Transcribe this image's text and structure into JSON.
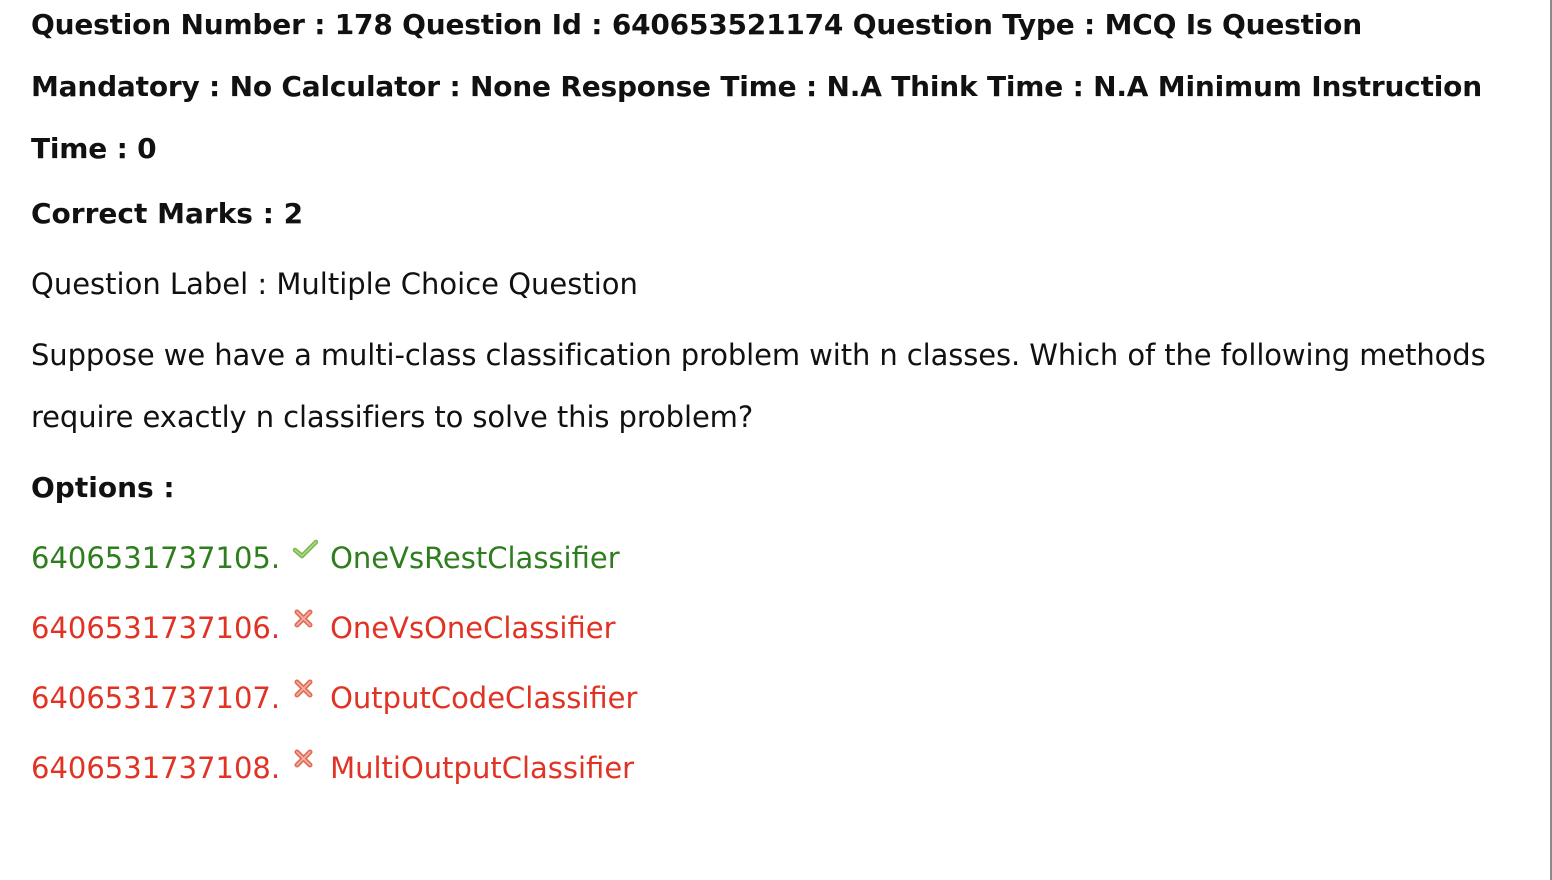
{
  "header": {
    "text": "Question Number : 178 Question Id : 640653521174 Question Type : MCQ Is Question Mandatory : No Calculator : None Response Time : N.A Think Time : N.A Minimum Instruction Time : 0"
  },
  "marks": {
    "text": "Correct Marks : 2"
  },
  "question_label": {
    "text": "Question Label : Multiple Choice Question"
  },
  "question": {
    "text": "Suppose we have a multi-class classification problem with n classes. Which of the following methods require exactly n classifiers to solve this problem?"
  },
  "options_heading": "Options :",
  "options": [
    {
      "id": "6406531737105.",
      "label": "OneVsRestClassifier",
      "status": "correct",
      "icon": "check-icon",
      "color": "#2e7d1e"
    },
    {
      "id": "6406531737106.",
      "label": "OneVsOneClassifier",
      "status": "wrong",
      "icon": "cross-icon",
      "color": "#e03324"
    },
    {
      "id": "6406531737107.",
      "label": "OutputCodeClassifier",
      "status": "wrong",
      "icon": "cross-icon",
      "color": "#e03324"
    },
    {
      "id": "6406531737108.",
      "label": "MultiOutputClassifier",
      "status": "wrong",
      "icon": "cross-icon",
      "color": "#e03324"
    }
  ]
}
